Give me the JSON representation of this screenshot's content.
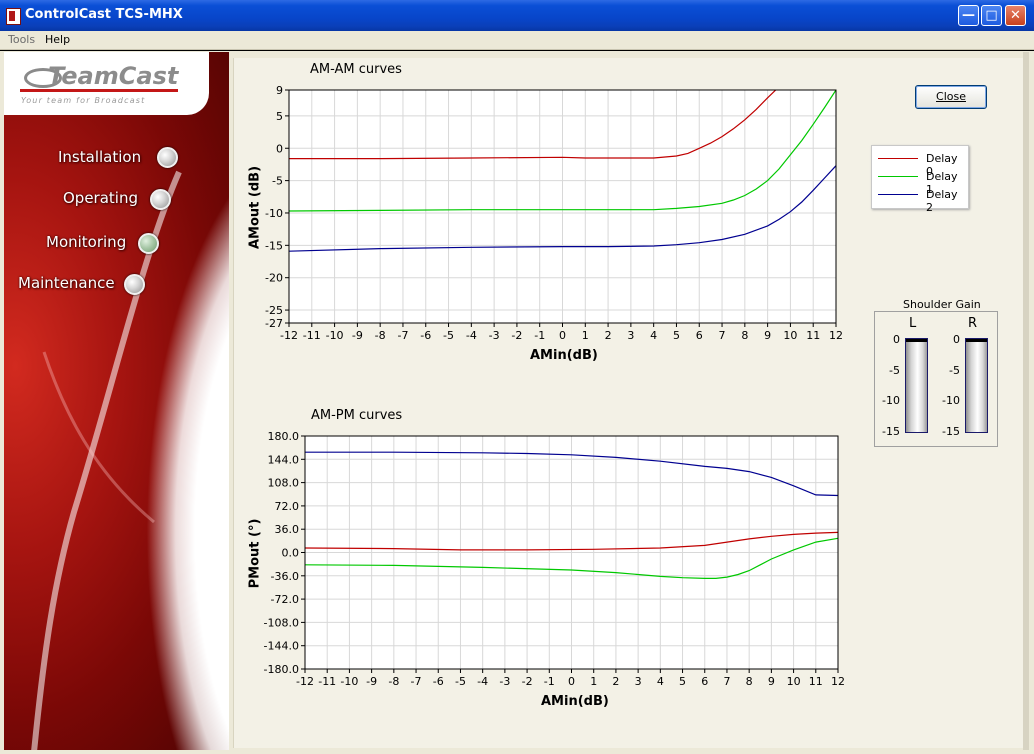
{
  "window": {
    "title": "ControlCast TCS-MHX"
  },
  "menu": {
    "items": [
      {
        "label": "Tools",
        "enabled": false
      },
      {
        "label": "Help",
        "enabled": true
      }
    ]
  },
  "logo": {
    "name": "TeamCast",
    "tagline": "Your team for Broadcast"
  },
  "nav": {
    "items": [
      {
        "label": "Installation",
        "active": false
      },
      {
        "label": "Operating",
        "active": false
      },
      {
        "label": "Monitoring",
        "active": true
      },
      {
        "label": "Maintenance",
        "active": false
      }
    ]
  },
  "close_button": {
    "label": "Close"
  },
  "legend": [
    {
      "label": "Delay 0",
      "color": "#c00000"
    },
    {
      "label": "Delay 1",
      "color": "#00c800"
    },
    {
      "label": "Delay 2",
      "color": "#000090"
    }
  ],
  "shoulder_gain": {
    "title": "Shoulder Gain",
    "channels": [
      {
        "label": "L",
        "value": 0
      },
      {
        "label": "R",
        "value": 0
      }
    ],
    "ticks": [
      "0",
      "-5",
      "-10",
      "-15"
    ]
  },
  "chart_data": [
    {
      "type": "line",
      "title": "AM-AM curves",
      "xlabel": "AMin(dB)",
      "ylabel": "AMout (dB)",
      "xlim": [
        -12,
        12
      ],
      "ylim": [
        -27,
        9
      ],
      "xticks": [
        "-12",
        "-11",
        "-10",
        "-9",
        "-8",
        "-7",
        "-6",
        "-5",
        "-4",
        "-3",
        "-2",
        "-1",
        "0",
        "1",
        "2",
        "3",
        "4",
        "5",
        "6",
        "7",
        "8",
        "9",
        "10",
        "11",
        "12"
      ],
      "yticks": [
        "9",
        "5",
        "0",
        "-5",
        "-10",
        "-15",
        "-20",
        "-25",
        "-27"
      ],
      "grid": true,
      "series": [
        {
          "name": "Delay 0",
          "color": "#c00000",
          "x": [
            -12,
            -8,
            -4,
            0,
            1,
            2,
            3,
            4,
            5,
            5.5,
            6,
            6.5,
            7,
            7.5,
            8,
            8.5,
            9,
            9.5
          ],
          "y": [
            -1.6,
            -1.6,
            -1.5,
            -1.4,
            -1.5,
            -1.5,
            -1.5,
            -1.5,
            -1.2,
            -0.8,
            0.0,
            0.8,
            1.8,
            3.0,
            4.4,
            6.0,
            7.8,
            9.5
          ]
        },
        {
          "name": "Delay 1",
          "color": "#00c800",
          "x": [
            -12,
            -8,
            -4,
            0,
            2,
            4,
            5,
            6,
            7,
            7.5,
            8,
            8.5,
            9,
            9.5,
            10,
            10.5,
            11,
            11.5,
            12
          ],
          "y": [
            -9.7,
            -9.6,
            -9.5,
            -9.5,
            -9.5,
            -9.5,
            -9.3,
            -9.0,
            -8.5,
            -8.0,
            -7.3,
            -6.3,
            -5.0,
            -3.2,
            -1.0,
            1.2,
            3.7,
            6.3,
            9.0
          ]
        },
        {
          "name": "Delay 2",
          "color": "#000090",
          "x": [
            -12,
            -8,
            -4,
            0,
            2,
            4,
            5,
            6,
            7,
            8,
            9,
            9.5,
            10,
            10.5,
            11,
            11.5,
            12
          ],
          "y": [
            -15.9,
            -15.5,
            -15.3,
            -15.2,
            -15.2,
            -15.1,
            -14.9,
            -14.6,
            -14.1,
            -13.3,
            -12.0,
            -11.0,
            -9.8,
            -8.3,
            -6.5,
            -4.6,
            -2.7
          ]
        }
      ]
    },
    {
      "type": "line",
      "title": "AM-PM curves",
      "xlabel": "AMin(dB)",
      "ylabel": "PMout (°)",
      "xlim": [
        -12,
        12
      ],
      "ylim": [
        -180,
        180
      ],
      "xticks": [
        "-12",
        "-11",
        "-10",
        "-9",
        "-8",
        "-7",
        "-6",
        "-5",
        "-4",
        "-3",
        "-2",
        "-1",
        "0",
        "1",
        "2",
        "3",
        "4",
        "5",
        "6",
        "7",
        "8",
        "9",
        "10",
        "11",
        "12"
      ],
      "yticks": [
        "180.0",
        "144.0",
        "108.0",
        "72.0",
        "36.0",
        "0.0",
        "-36.0",
        "-72.0",
        "-108.0",
        "-144.0",
        "-180.0"
      ],
      "grid": true,
      "series": [
        {
          "name": "Delay 0",
          "color": "#c00000",
          "x": [
            -12,
            -8,
            -5,
            -2,
            1,
            4,
            6,
            7,
            8,
            9,
            10,
            11,
            12
          ],
          "y": [
            7,
            6,
            4,
            4,
            5,
            7,
            11,
            16,
            21,
            25,
            28,
            30,
            31
          ]
        },
        {
          "name": "Delay 1",
          "color": "#00c800",
          "x": [
            -12,
            -8,
            -4,
            0,
            2,
            4,
            5,
            6,
            6.5,
            7,
            7.5,
            8,
            8.5,
            9,
            10,
            11,
            12
          ],
          "y": [
            -19,
            -20,
            -23,
            -27,
            -31,
            -37,
            -39,
            -40,
            -40,
            -38,
            -34,
            -28,
            -19,
            -10,
            4,
            16,
            22
          ]
        },
        {
          "name": "Delay 2",
          "color": "#000090",
          "x": [
            -12,
            -8,
            -4,
            -2,
            0,
            2,
            4,
            6,
            7,
            8,
            9,
            10,
            11,
            12
          ],
          "y": [
            155,
            155,
            154,
            153,
            151,
            147,
            141,
            133,
            130,
            125,
            116,
            103,
            89,
            88
          ]
        }
      ]
    }
  ]
}
